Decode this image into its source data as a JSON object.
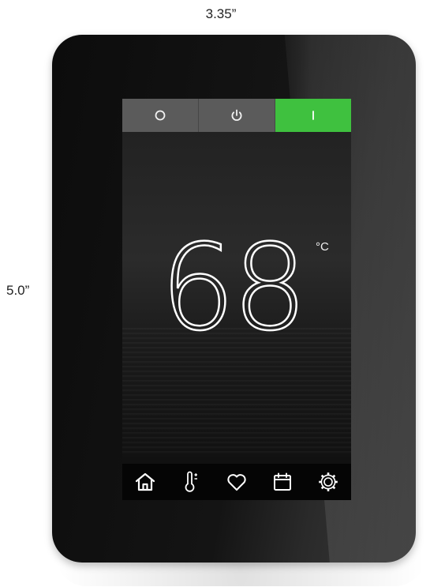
{
  "dimensions": {
    "width_label": "3.35”",
    "height_label": "5.0”"
  },
  "mode_buttons": [
    {
      "icon": "circle-off-icon",
      "state": "inactive"
    },
    {
      "icon": "power-icon",
      "state": "inactive"
    },
    {
      "icon": "on-bar-icon",
      "state": "active"
    }
  ],
  "display": {
    "temperature": "68",
    "unit": "°C"
  },
  "nav_buttons": [
    {
      "icon": "home-icon"
    },
    {
      "icon": "thermometer-icon"
    },
    {
      "icon": "heart-icon"
    },
    {
      "icon": "calendar-icon"
    },
    {
      "icon": "gear-icon"
    }
  ],
  "colors": {
    "active_mode": "#3fc13f",
    "inactive_mode": "#5b5b5b",
    "bezel": "#111111",
    "icon": "#ffffff"
  }
}
